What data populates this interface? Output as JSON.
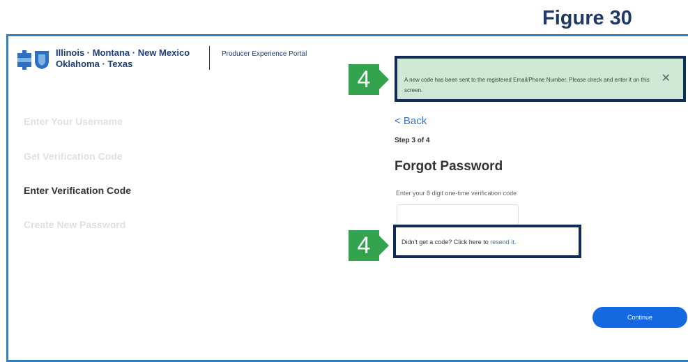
{
  "figure_label": "Figure 30",
  "header": {
    "brand_line1": "Illinois · Montana · New Mexico",
    "brand_line2": "Oklahoma · Texas",
    "portal_name": "Producer Experience Portal"
  },
  "steps": [
    {
      "label": "Enter Your Username",
      "active": false
    },
    {
      "label": "Get Verification Code",
      "active": false
    },
    {
      "label": "Enter Verification Code",
      "active": true
    },
    {
      "label": "Create New Password",
      "active": false
    }
  ],
  "alert": {
    "message": "A new code has been sent to the registered Email/Phone Number. Please check and enter it on this screen.",
    "close_glyph": "✕"
  },
  "callouts": {
    "badge_1": "4",
    "badge_2": "4"
  },
  "form": {
    "back_label": "< Back",
    "step_indicator": "Step 3 of 4",
    "title": "Forgot Password",
    "code_prompt": "Enter your 8 digit one-time verification code",
    "code_value": "",
    "resend_prefix": "Didn't get a code? Click here to ",
    "resend_link": "resend it.",
    "continue_label": "Continue"
  },
  "colors": {
    "frame_blue": "#2f80c9",
    "callout_green": "#33a34d",
    "callout_border_navy": "#0f2b56",
    "button_blue": "#1469e0"
  },
  "icons": [
    "bcbs-logo-icon",
    "close-icon"
  ]
}
